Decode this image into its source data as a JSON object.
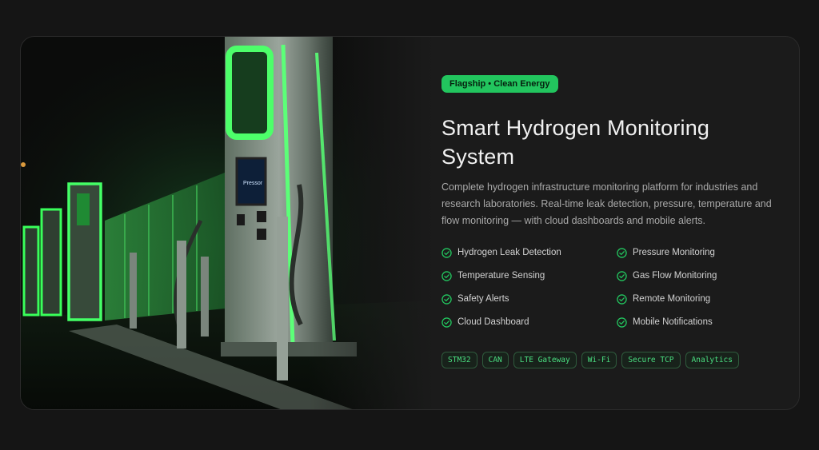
{
  "hero": {
    "badge": "Flagship • Clean Energy",
    "title": "Smart Hydrogen Monitoring System",
    "description": "Complete hydrogen infrastructure monitoring platform for industries and research laboratories. Real-time leak detection, pressure, temperature and flow monitoring — with cloud dashboards and mobile alerts.",
    "image_screen_text": "Pressor"
  },
  "features": [
    {
      "label": "Hydrogen Leak Detection",
      "icon": "check-circle-icon"
    },
    {
      "label": "Pressure Monitoring",
      "icon": "check-circle-icon"
    },
    {
      "label": "Temperature Sensing",
      "icon": "check-circle-icon"
    },
    {
      "label": "Gas Flow Monitoring",
      "icon": "check-circle-icon"
    },
    {
      "label": "Safety Alerts",
      "icon": "check-circle-icon"
    },
    {
      "label": "Remote Monitoring",
      "icon": "check-circle-icon"
    },
    {
      "label": "Cloud Dashboard",
      "icon": "check-circle-icon"
    },
    {
      "label": "Mobile Notifications",
      "icon": "check-circle-icon"
    }
  ],
  "tags": [
    "STM32",
    "CAN",
    "LTE Gateway",
    "Wi-Fi",
    "Secure TCP",
    "Analytics"
  ],
  "colors": {
    "accent": "#22c55e",
    "tag_text": "#4ade80",
    "background": "#151515",
    "card": "#1b1b1b"
  }
}
